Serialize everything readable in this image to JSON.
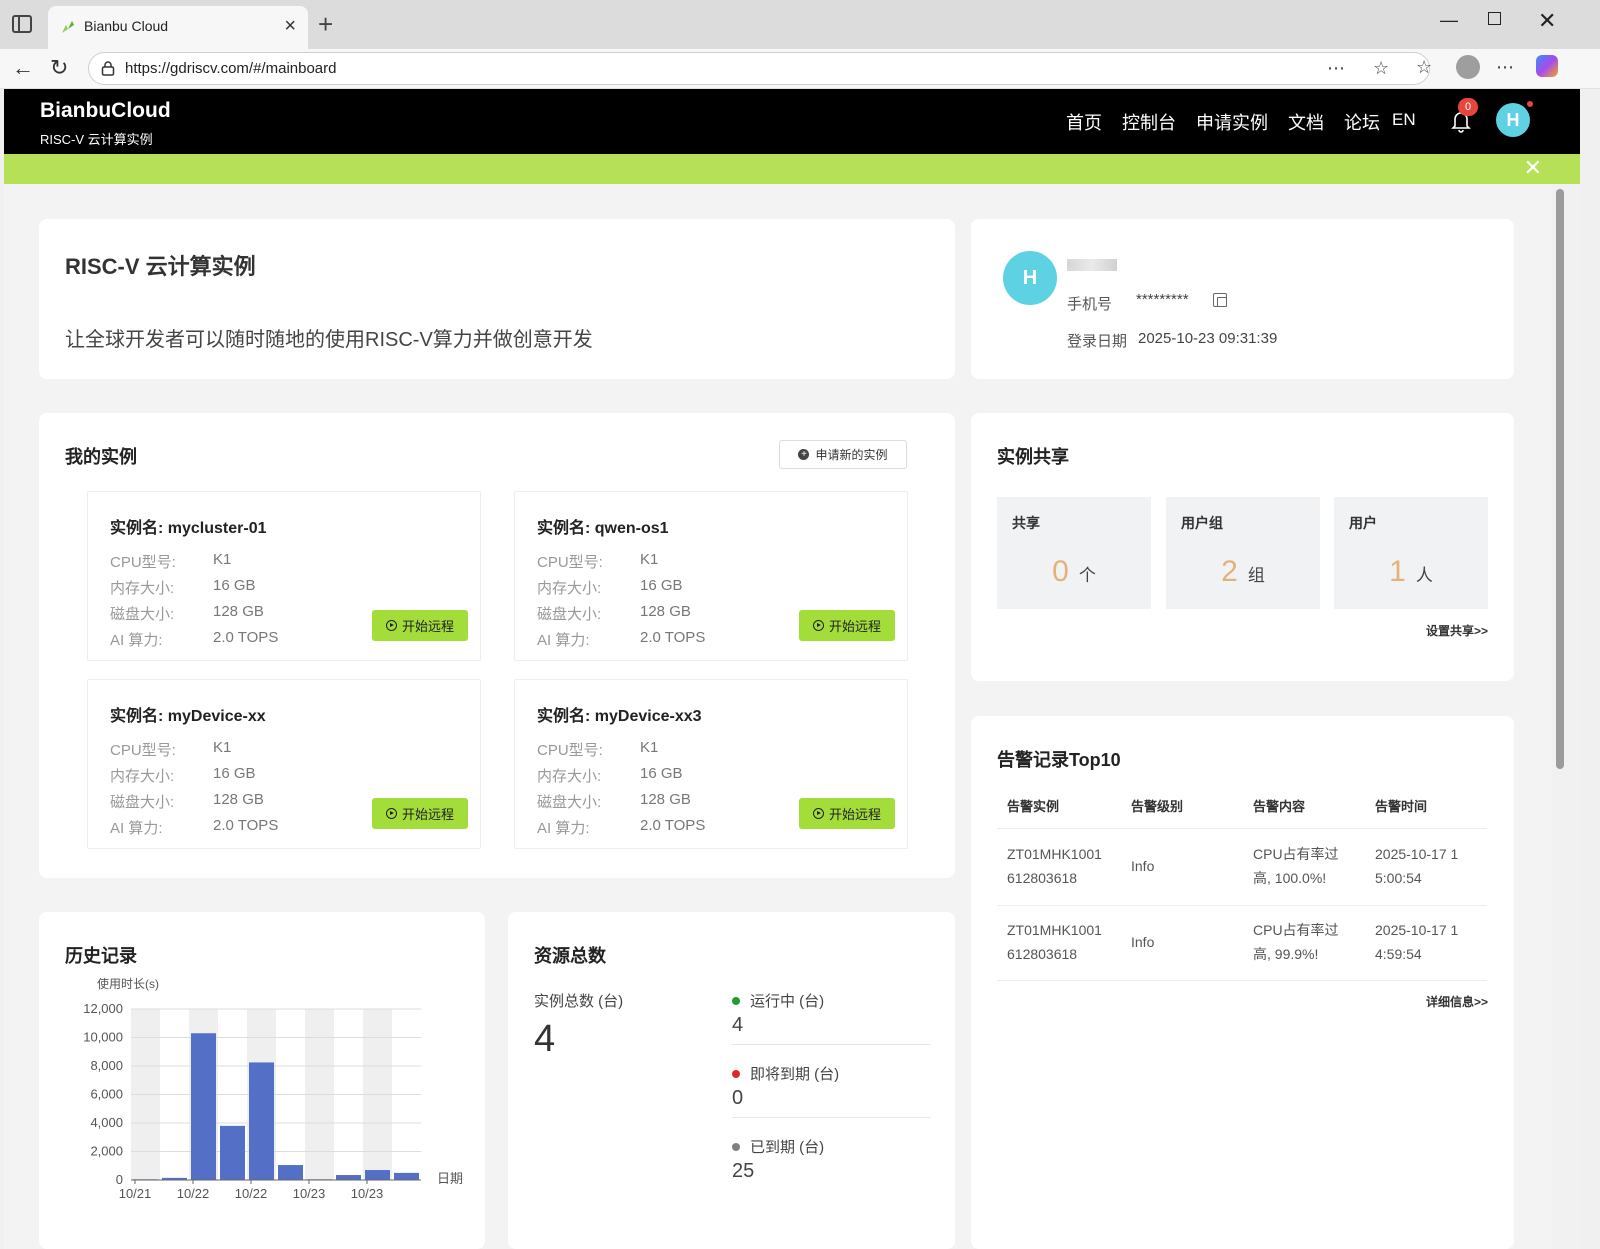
{
  "browser": {
    "tab_title": "Bianbu Cloud",
    "url": "https://gdriscv.com/#/mainboard"
  },
  "header": {
    "brand": "BianbuCloud",
    "brand_sub": "RISC-V 云计算实例",
    "nav": [
      "首页",
      "控制台",
      "申请实例",
      "文档",
      "论坛"
    ],
    "lang": "EN",
    "notif_count": "0",
    "avatar": "H"
  },
  "intro": {
    "title": "RISC-V 云计算实例",
    "desc": "让全球开发者可以随时随地的使用RISC-V算力并做创意开发"
  },
  "profile": {
    "avatar": "H",
    "phone_label": "手机号",
    "phone_value": "*********",
    "login_label": "登录日期",
    "login_value": "2025-10-23 09:31:39"
  },
  "instances": {
    "title": "我的实例",
    "apply_label": "申请新的实例",
    "start_label": "开始远程",
    "field_labels": [
      "CPU型号:",
      "内存大小:",
      "磁盘大小:",
      "AI 算力:"
    ],
    "items": [
      {
        "name": "实例名:  mycluster-01",
        "values": [
          "K1",
          "16 GB",
          "128 GB",
          "2.0 TOPS"
        ]
      },
      {
        "name": "实例名:  qwen-os1",
        "values": [
          "K1",
          "16 GB",
          "128 GB",
          "2.0 TOPS"
        ]
      },
      {
        "name": "实例名:  myDevice-xx",
        "values": [
          "K1",
          "16 GB",
          "128 GB",
          "2.0 TOPS"
        ]
      },
      {
        "name": "实例名:  myDevice-xx3",
        "values": [
          "K1",
          "16 GB",
          "128 GB",
          "2.0 TOPS"
        ]
      }
    ]
  },
  "share": {
    "title": "实例共享",
    "boxes": [
      {
        "label": "共享",
        "value": "0",
        "unit": "个"
      },
      {
        "label": "用户组",
        "value": "2",
        "unit": "组"
      },
      {
        "label": "用户",
        "value": "1",
        "unit": "人"
      }
    ],
    "more": "设置共享>>"
  },
  "alerts": {
    "title": "告警记录Top10",
    "headers": [
      "告警实例",
      "告警级别",
      "告警内容",
      "告警时间"
    ],
    "rows": [
      {
        "instance": [
          "ZT01MHK1001",
          "612803618"
        ],
        "level": "Info",
        "content": [
          "CPU占有率过",
          "高, 100.0%!"
        ],
        "time": [
          "2025-10-17 1",
          "5:00:54"
        ]
      },
      {
        "instance": [
          "ZT01MHK1001",
          "612803618"
        ],
        "level": "Info",
        "content": [
          "CPU占有率过",
          "高, 99.9%!"
        ],
        "time": [
          "2025-10-17 1",
          "4:59:54"
        ]
      }
    ],
    "more": "详细信息>>"
  },
  "history": {
    "title": "历史记录"
  },
  "chart_data": {
    "type": "bar",
    "ylabel": "使用时长(s)",
    "xlabel": "日期",
    "ylim": [
      0,
      12000
    ],
    "yticks": [
      "0",
      "2,000",
      "4,000",
      "6,000",
      "8,000",
      "10,000",
      "12,000"
    ],
    "xtick_labels": [
      "10/21",
      "10/22",
      "10/22",
      "10/23",
      "10/23"
    ],
    "values": [
      50,
      150,
      10300,
      3800,
      8250,
      1050,
      50,
      350,
      700,
      500
    ],
    "bar_color": "#5470c6",
    "grid": true
  },
  "resources": {
    "title": "资源总数",
    "total_label": "实例总数 (台)",
    "total_value": "4",
    "stats": [
      {
        "label": "运行中 (台)",
        "value": "4",
        "color": "#1e9e2e"
      },
      {
        "label": "即将到期 (台)",
        "value": "0",
        "color": "#e0262c"
      },
      {
        "label": "已到期 (台)",
        "value": "25",
        "color": "#808080"
      }
    ]
  }
}
